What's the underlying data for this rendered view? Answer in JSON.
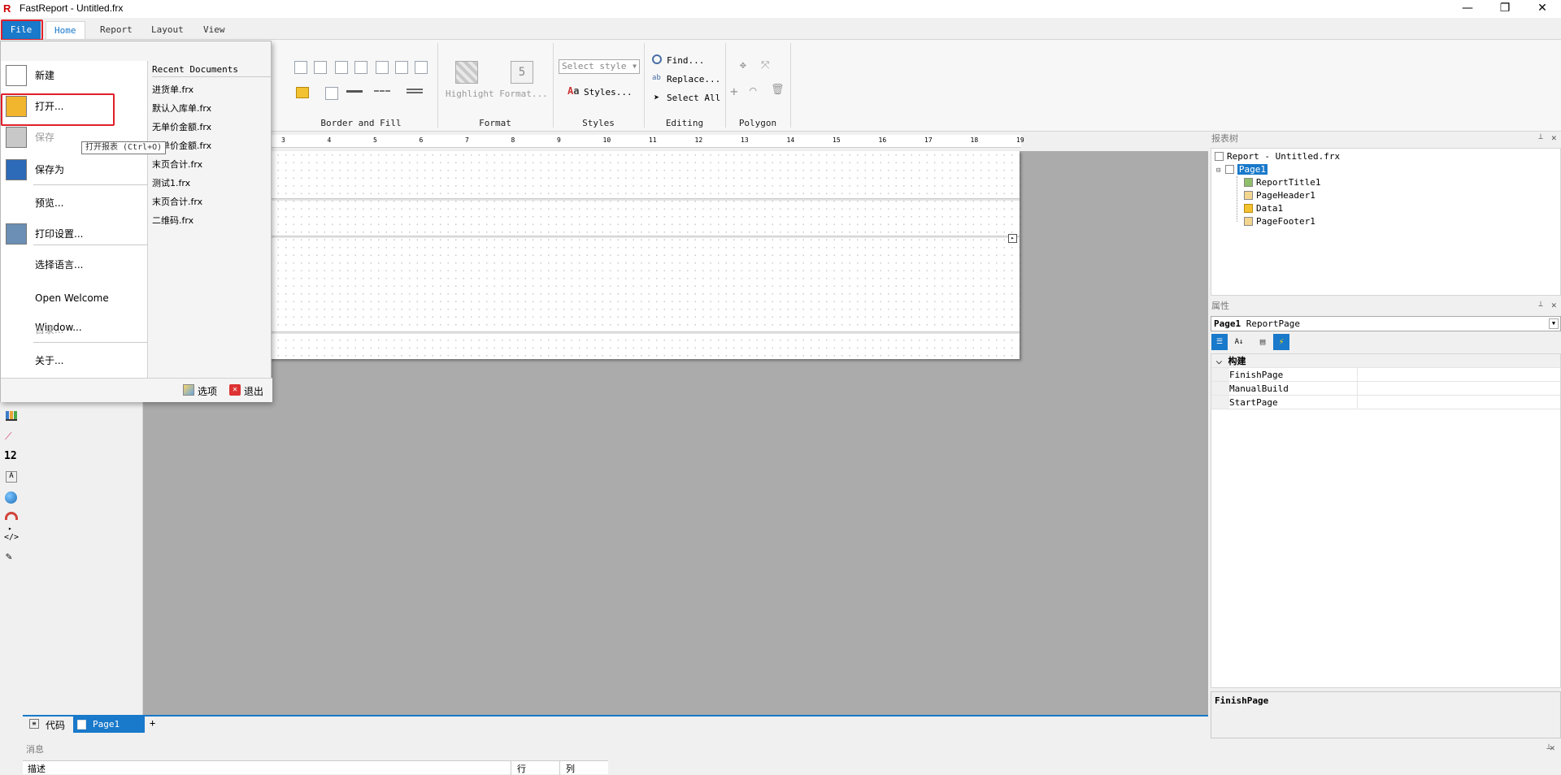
{
  "window": {
    "title": "FastReport - Untitled.frx"
  },
  "tabs": {
    "file": "File",
    "home": "Home",
    "report": "Report",
    "layout": "Layout",
    "view": "View"
  },
  "ribbon": {
    "border_fill": "Border and Fill",
    "format_group": "Format",
    "styles_group": "Styles",
    "editing_group": "Editing",
    "polygon_group": "Polygon",
    "highlight": "Highlight",
    "format_btn": "Format...",
    "select_style": "Select style",
    "styles_btn": "Styles...",
    "find": "Find...",
    "replace": "Replace...",
    "select_all": "Select All"
  },
  "ruler": [
    "3",
    "4",
    "5",
    "6",
    "7",
    "8",
    "9",
    "10",
    "11",
    "12",
    "13",
    "14",
    "15",
    "16",
    "17",
    "18",
    "19"
  ],
  "file_menu": {
    "items": [
      {
        "label": "新建",
        "icon": "new-document-icon",
        "disabled": false
      },
      {
        "label": "打开...",
        "icon": "open-folder-icon",
        "disabled": false
      },
      {
        "label": "保存",
        "icon": "save-icon",
        "disabled": true
      },
      {
        "label": "保存为",
        "icon": "save-as-icon",
        "disabled": false
      },
      {
        "label": "预览...",
        "icon": "",
        "disabled": false
      },
      {
        "label": "打印设置...",
        "icon": "printer-icon",
        "disabled": false
      },
      {
        "label": "选择语言...",
        "icon": "",
        "disabled": false
      },
      {
        "label": "Open Welcome Window...",
        "icon": "",
        "disabled": false
      },
      {
        "label": "目录...",
        "icon": "",
        "disabled": true
      },
      {
        "label": "关于...",
        "icon": "",
        "disabled": false
      }
    ],
    "recent_header": "Recent Documents",
    "recent": [
      "进货单.frx",
      "默认入库单.frx",
      "无单价金额.frx",
      "无单价金额.frx",
      "末页合计.frx",
      "测试1.frx",
      "末页合计.frx",
      "二维码.frx"
    ],
    "options": "选项",
    "exit": "退出",
    "tooltip": "打开报表 (Ctrl+O)"
  },
  "report_tree": {
    "title": "报表树",
    "root": "Report - Untitled.frx",
    "page": "Page1",
    "children": [
      "ReportTitle1",
      "PageHeader1",
      "Data1",
      "PageFooter1"
    ]
  },
  "properties": {
    "title": "属性",
    "object_name": "Page1",
    "object_type": "ReportPage",
    "category": "构建",
    "rows": [
      "FinishPage",
      "ManualBuild",
      "StartPage"
    ],
    "description_title": "FinishPage"
  },
  "bottom_tabs": {
    "code": "代码",
    "page": "Page1",
    "add": "+"
  },
  "messages": {
    "title": "消息",
    "col_desc": "描述",
    "col_row": "行",
    "col_col": "列"
  },
  "colors": {
    "accent": "#1979ca",
    "highlight_box": "#e0202a"
  }
}
